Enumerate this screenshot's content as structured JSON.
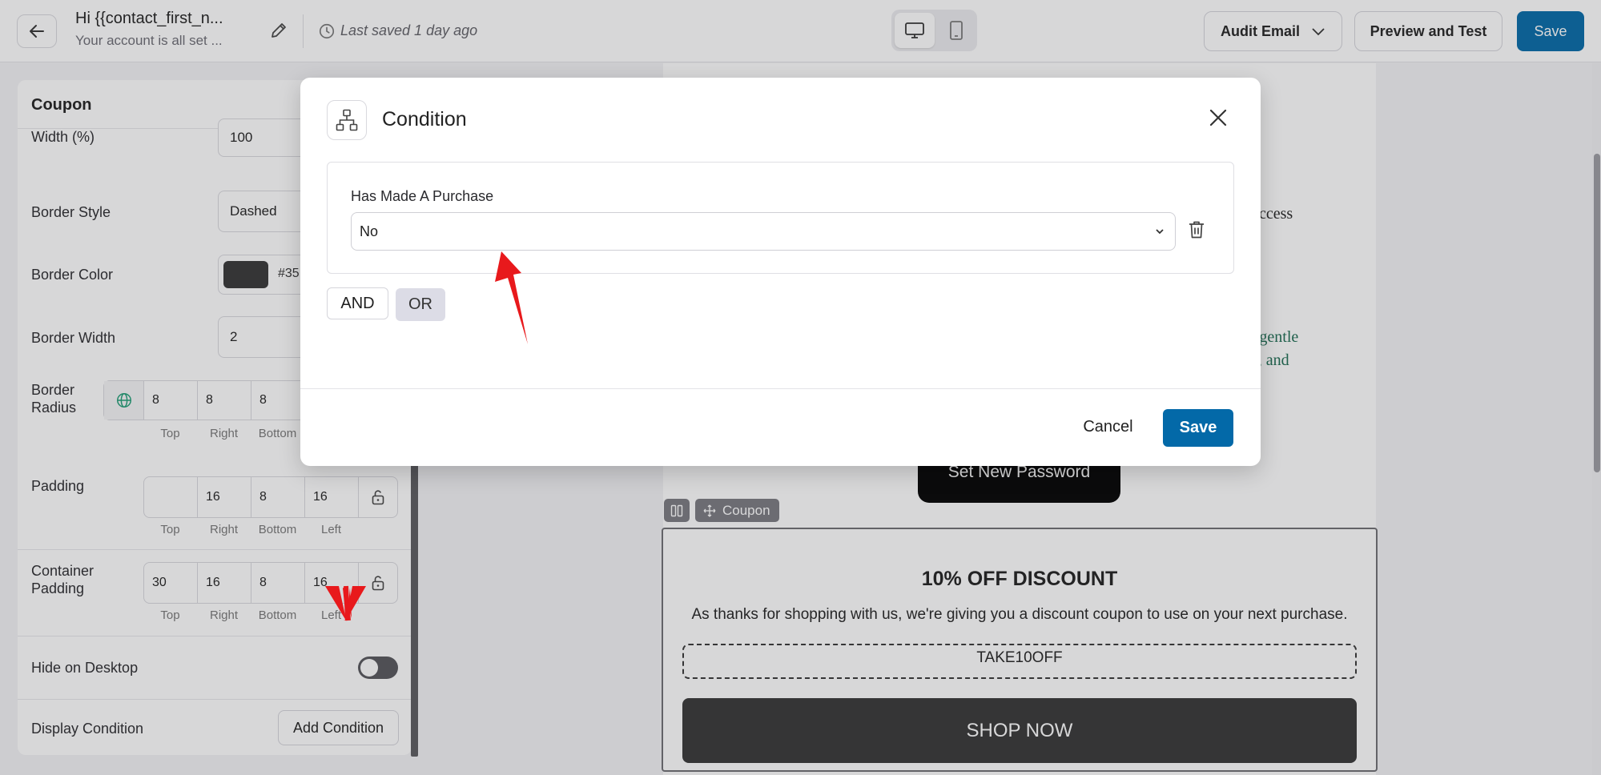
{
  "header": {
    "email_title": "Hi {{contact_first_n...",
    "email_subtitle": "Your account is all set ...",
    "last_saved": "Last saved 1 day ago",
    "audit_label": "Audit Email",
    "preview_label": "Preview and Test",
    "save_label": "Save"
  },
  "panel": {
    "title": "Coupon",
    "width_label": "Width (%)",
    "width_value": "100",
    "border_style_label": "Border Style",
    "border_style_value": "Dashed",
    "border_color_label": "Border Color",
    "border_color_value": "#35",
    "border_color_swatch": "#353535",
    "border_width_label": "Border Width",
    "border_width_value": "2",
    "border_radius_label_1": "Border",
    "border_radius_label_2": "Radius",
    "border_radius_values": [
      "8",
      "8",
      "8"
    ],
    "radius_sublabels": [
      "Top",
      "Right",
      "Bottom"
    ],
    "padding_label": "Padding",
    "padding_values": [
      "",
      "16",
      "8",
      "16"
    ],
    "sublabels": [
      "Top",
      "Right",
      "Bottom",
      "Left"
    ],
    "container_padding_label_1": "Container",
    "container_padding_label_2": "Padding",
    "container_padding_values": [
      "30",
      "16",
      "8",
      "16"
    ],
    "hide_desktop_label": "Hide on Desktop",
    "display_condition_label": "Display Condition",
    "add_condition_label": "Add Condition"
  },
  "email": {
    "partial_text_1": "ccess",
    "partial_text_2a": "are gentle",
    "partial_text_2b": "tful, and",
    "set_password_label": "Set New Password",
    "block_chip_label": "Coupon",
    "coupon_title": "10% OFF DISCOUNT",
    "coupon_description": "As thanks for shopping with us, we're giving you a discount coupon to use on your next purchase.",
    "coupon_code": "TAKE10OFF",
    "shop_now_label": "SHOP NOW"
  },
  "modal": {
    "title": "Condition",
    "condition_label": "Has Made A Purchase",
    "condition_value": "No",
    "and_label": "AND",
    "or_label": "OR",
    "cancel_label": "Cancel",
    "save_label": "Save"
  },
  "colors": {
    "primary": "#0369a8",
    "annotation_arrow": "#e8191c",
    "coupon_dark": "#353535"
  }
}
